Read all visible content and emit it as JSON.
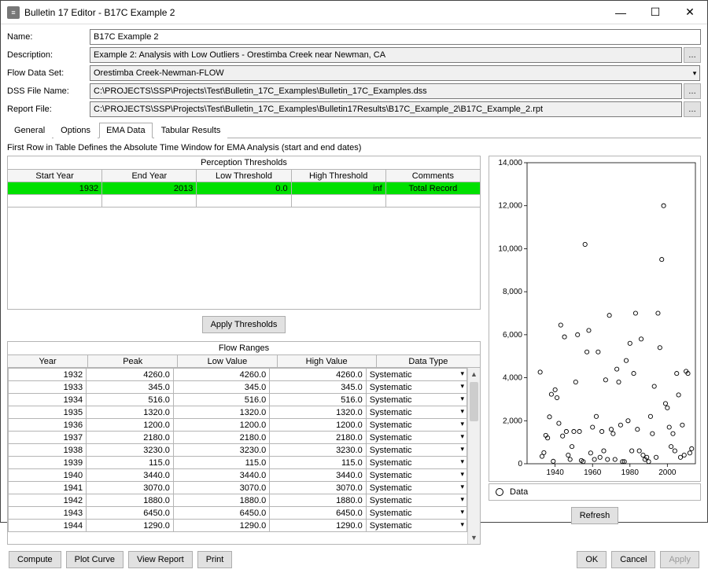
{
  "window": {
    "title": "Bulletin 17 Editor - B17C Example 2"
  },
  "form": {
    "name_label": "Name:",
    "name_value": "B17C Example 2",
    "desc_label": "Description:",
    "desc_value": "Example 2: Analysis with Low Outliers - Orestimba Creek near Newman, CA",
    "flowset_label": "Flow Data Set:",
    "flowset_value": "Orestimba Creek-Newman-FLOW",
    "dss_label": "DSS File Name:",
    "dss_value": "C:\\PROJECTS\\SSP\\Projects\\Test\\Bulletin_17C_Examples\\Bulletin_17C_Examples.dss",
    "report_label": "Report File:",
    "report_value": "C:\\PROJECTS\\SSP\\Projects\\Test\\Bulletin_17C_Examples\\Bulletin17Results\\B17C_Example_2\\B17C_Example_2.rpt"
  },
  "tabs": {
    "general": "General",
    "options": "Options",
    "ema": "EMA Data",
    "tabular": "Tabular Results"
  },
  "hint": "First Row in Table Defines the Absolute Time Window for EMA Analysis (start and end dates)",
  "perception": {
    "title": "Perception Thresholds",
    "headers": [
      "Start Year",
      "End Year",
      "Low Threshold",
      "High Threshold",
      "Comments"
    ],
    "row": {
      "start": "1932",
      "end": "2013",
      "low": "0.0",
      "high": "inf",
      "comments": "Total Record"
    }
  },
  "apply_btn": "Apply Thresholds",
  "flow": {
    "title": "Flow Ranges",
    "headers": [
      "Year",
      "Peak",
      "Low Value",
      "High Value",
      "Data Type"
    ],
    "rows": [
      {
        "y": "1932",
        "p": "4260.0",
        "l": "4260.0",
        "h": "4260.0",
        "t": "Systematic"
      },
      {
        "y": "1933",
        "p": "345.0",
        "l": "345.0",
        "h": "345.0",
        "t": "Systematic"
      },
      {
        "y": "1934",
        "p": "516.0",
        "l": "516.0",
        "h": "516.0",
        "t": "Systematic"
      },
      {
        "y": "1935",
        "p": "1320.0",
        "l": "1320.0",
        "h": "1320.0",
        "t": "Systematic"
      },
      {
        "y": "1936",
        "p": "1200.0",
        "l": "1200.0",
        "h": "1200.0",
        "t": "Systematic"
      },
      {
        "y": "1937",
        "p": "2180.0",
        "l": "2180.0",
        "h": "2180.0",
        "t": "Systematic"
      },
      {
        "y": "1938",
        "p": "3230.0",
        "l": "3230.0",
        "h": "3230.0",
        "t": "Systematic"
      },
      {
        "y": "1939",
        "p": "115.0",
        "l": "115.0",
        "h": "115.0",
        "t": "Systematic"
      },
      {
        "y": "1940",
        "p": "3440.0",
        "l": "3440.0",
        "h": "3440.0",
        "t": "Systematic"
      },
      {
        "y": "1941",
        "p": "3070.0",
        "l": "3070.0",
        "h": "3070.0",
        "t": "Systematic"
      },
      {
        "y": "1942",
        "p": "1880.0",
        "l": "1880.0",
        "h": "1880.0",
        "t": "Systematic"
      },
      {
        "y": "1943",
        "p": "6450.0",
        "l": "6450.0",
        "h": "6450.0",
        "t": "Systematic"
      },
      {
        "y": "1944",
        "p": "1290.0",
        "l": "1290.0",
        "h": "1290.0",
        "t": "Systematic"
      }
    ]
  },
  "chart_data": {
    "type": "scatter",
    "xlabel": "",
    "ylabel": "",
    "xlim": [
      1925,
      2015
    ],
    "ylim": [
      0,
      14000
    ],
    "xticks": [
      1940,
      1960,
      1980,
      2000
    ],
    "yticks": [
      0,
      2000,
      4000,
      6000,
      8000,
      10000,
      12000,
      14000
    ],
    "legend": "Data",
    "series": [
      {
        "name": "Data",
        "points": [
          [
            1932,
            4260
          ],
          [
            1933,
            345
          ],
          [
            1934,
            516
          ],
          [
            1935,
            1320
          ],
          [
            1936,
            1200
          ],
          [
            1937,
            2180
          ],
          [
            1938,
            3230
          ],
          [
            1939,
            115
          ],
          [
            1940,
            3440
          ],
          [
            1941,
            3070
          ],
          [
            1942,
            1880
          ],
          [
            1943,
            6450
          ],
          [
            1944,
            1290
          ],
          [
            1945,
            5900
          ],
          [
            1946,
            1500
          ],
          [
            1947,
            400
          ],
          [
            1948,
            200
          ],
          [
            1949,
            800
          ],
          [
            1950,
            1500
          ],
          [
            1951,
            3800
          ],
          [
            1952,
            6000
          ],
          [
            1953,
            1500
          ],
          [
            1954,
            150
          ],
          [
            1955,
            100
          ],
          [
            1956,
            10200
          ],
          [
            1957,
            5200
          ],
          [
            1958,
            6200
          ],
          [
            1959,
            500
          ],
          [
            1960,
            1700
          ],
          [
            1961,
            200
          ],
          [
            1962,
            2200
          ],
          [
            1963,
            5200
          ],
          [
            1964,
            300
          ],
          [
            1965,
            1500
          ],
          [
            1966,
            600
          ],
          [
            1967,
            3900
          ],
          [
            1968,
            200
          ],
          [
            1969,
            6900
          ],
          [
            1970,
            1600
          ],
          [
            1971,
            1400
          ],
          [
            1972,
            200
          ],
          [
            1973,
            4400
          ],
          [
            1974,
            3800
          ],
          [
            1975,
            1800
          ],
          [
            1976,
            100
          ],
          [
            1977,
            100
          ],
          [
            1978,
            4800
          ],
          [
            1979,
            2000
          ],
          [
            1980,
            5600
          ],
          [
            1981,
            600
          ],
          [
            1982,
            4200
          ],
          [
            1983,
            7000
          ],
          [
            1984,
            1600
          ],
          [
            1985,
            600
          ],
          [
            1986,
            5800
          ],
          [
            1987,
            400
          ],
          [
            1988,
            200
          ],
          [
            1989,
            300
          ],
          [
            1990,
            100
          ],
          [
            1991,
            2200
          ],
          [
            1992,
            1400
          ],
          [
            1993,
            3600
          ],
          [
            1994,
            300
          ],
          [
            1995,
            7000
          ],
          [
            1996,
            5400
          ],
          [
            1997,
            9500
          ],
          [
            1998,
            12000
          ],
          [
            1999,
            2800
          ],
          [
            2000,
            2600
          ],
          [
            2001,
            1700
          ],
          [
            2002,
            800
          ],
          [
            2003,
            1400
          ],
          [
            2004,
            600
          ],
          [
            2005,
            4200
          ],
          [
            2006,
            3200
          ],
          [
            2007,
            300
          ],
          [
            2008,
            1800
          ],
          [
            2009,
            400
          ],
          [
            2010,
            4300
          ],
          [
            2011,
            4200
          ],
          [
            2012,
            500
          ],
          [
            2013,
            700
          ]
        ]
      }
    ]
  },
  "refresh_btn": "Refresh",
  "footer": {
    "compute": "Compute",
    "plot": "Plot Curve",
    "view": "View Report",
    "print": "Print",
    "ok": "OK",
    "cancel": "Cancel",
    "apply": "Apply"
  }
}
